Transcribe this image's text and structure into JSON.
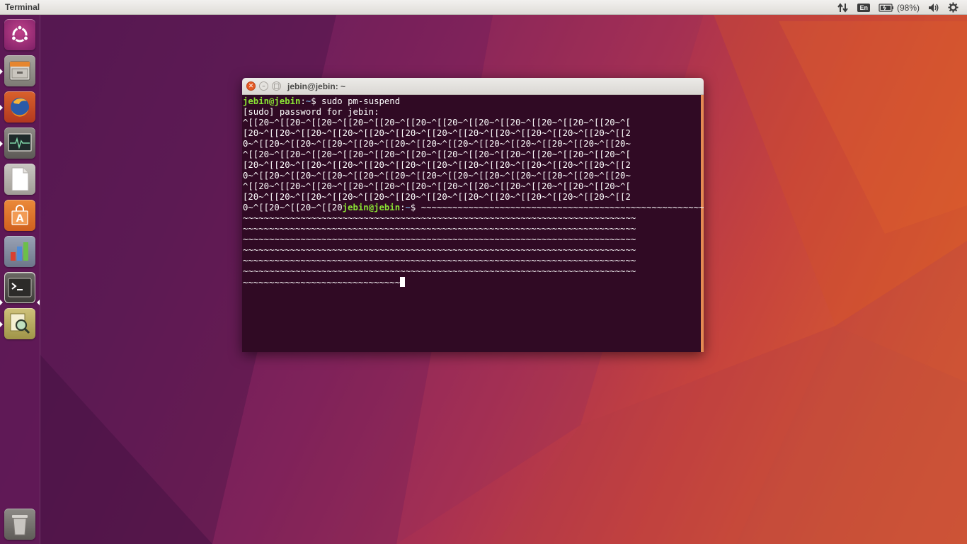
{
  "top_panel": {
    "app_title": "Terminal",
    "language": "En",
    "battery": "(98%)"
  },
  "launcher": {
    "items": [
      {
        "name": "dash",
        "icon": "ubuntu-logo-icon"
      },
      {
        "name": "files",
        "icon": "file-cabinet-icon"
      },
      {
        "name": "firefox",
        "icon": "firefox-icon"
      },
      {
        "name": "system-monitor",
        "icon": "system-monitor-icon"
      },
      {
        "name": "text-editor",
        "icon": "document-icon"
      },
      {
        "name": "software-center",
        "icon": "shopping-bag-icon"
      },
      {
        "name": "libreoffice-calc",
        "icon": "chart-icon"
      },
      {
        "name": "terminal",
        "icon": "terminal-icon"
      },
      {
        "name": "document-viewer",
        "icon": "magnifier-icon"
      },
      {
        "name": "trash",
        "icon": "trash-icon"
      }
    ]
  },
  "terminal": {
    "title": "jebin@jebin: ~",
    "prompt_user": "jebin@jebin",
    "prompt_path": "~",
    "prompt_symbol": "$",
    "command": " sudo pm-suspend",
    "password_line": "[sudo] password for jebin:",
    "escape_lines": [
      "^[[20~^[[20~^[[20~^[[20~^[[20~^[[20~^[[20~^[[20~^[[20~^[[20~^[[20~^[[20~^[",
      "[20~^[[20~^[[20~^[[20~^[[20~^[[20~^[[20~^[[20~^[[20~^[[20~^[[20~^[[20~^[[2",
      "0~^[[20~^[[20~^[[20~^[[20~^[[20~^[[20~^[[20~^[[20~^[[20~^[[20~^[[20~^[[20~",
      "^[[20~^[[20~^[[20~^[[20~^[[20~^[[20~^[[20~^[[20~^[[20~^[[20~^[[20~^[[20~^[",
      "[20~^[[20~^[[20~^[[20~^[[20~^[[20~^[[20~^[[20~^[[20~^[[20~^[[20~^[[20~^[[2",
      "0~^[[20~^[[20~^[[20~^[[20~^[[20~^[[20~^[[20~^[[20~^[[20~^[[20~^[[20~^[[20~",
      "^[[20~^[[20~^[[20~^[[20~^[[20~^[[20~^[[20~^[[20~^[[20~^[[20~^[[20~^[[20~^[",
      "[20~^[[20~^[[20~^[[20~^[[20~^[[20~^[[20~^[[20~^[[20~^[[20~^[[20~^[[20~^[[2"
    ],
    "last_escape_prefix": "0~^[[20~^[[20~^[[20",
    "tilde_after_prompt": " ~~~~~~~~~~~~~~~~~~~~~~~~~~~~~~~~~~~~~~~~~~~~~~~~~~~~~~~~~",
    "tilde_lines": [
      "~~~~~~~~~~~~~~~~~~~~~~~~~~~~~~~~~~~~~~~~~~~~~~~~~~~~~~~~~~~~~~~~~~~~~~~~~~~",
      "~~~~~~~~~~~~~~~~~~~~~~~~~~~~~~~~~~~~~~~~~~~~~~~~~~~~~~~~~~~~~~~~~~~~~~~~~~~",
      "~~~~~~~~~~~~~~~~~~~~~~~~~~~~~~~~~~~~~~~~~~~~~~~~~~~~~~~~~~~~~~~~~~~~~~~~~~~",
      "~~~~~~~~~~~~~~~~~~~~~~~~~~~~~~~~~~~~~~~~~~~~~~~~~~~~~~~~~~~~~~~~~~~~~~~~~~~",
      "~~~~~~~~~~~~~~~~~~~~~~~~~~~~~~~~~~~~~~~~~~~~~~~~~~~~~~~~~~~~~~~~~~~~~~~~~~~",
      "~~~~~~~~~~~~~~~~~~~~~~~~~~~~~~~~~~~~~~~~~~~~~~~~~~~~~~~~~~~~~~~~~~~~~~~~~~~"
    ],
    "tilde_last": "~~~~~~~~~~~~~~~~~~~~~~~~~~~~~~"
  },
  "colors": {
    "terminal_bg": "#300a24",
    "prompt_user": "#8ae234",
    "prompt_path": "#729fcf",
    "close_button": "#e45a24",
    "launcher_bg": "#5c1854"
  }
}
